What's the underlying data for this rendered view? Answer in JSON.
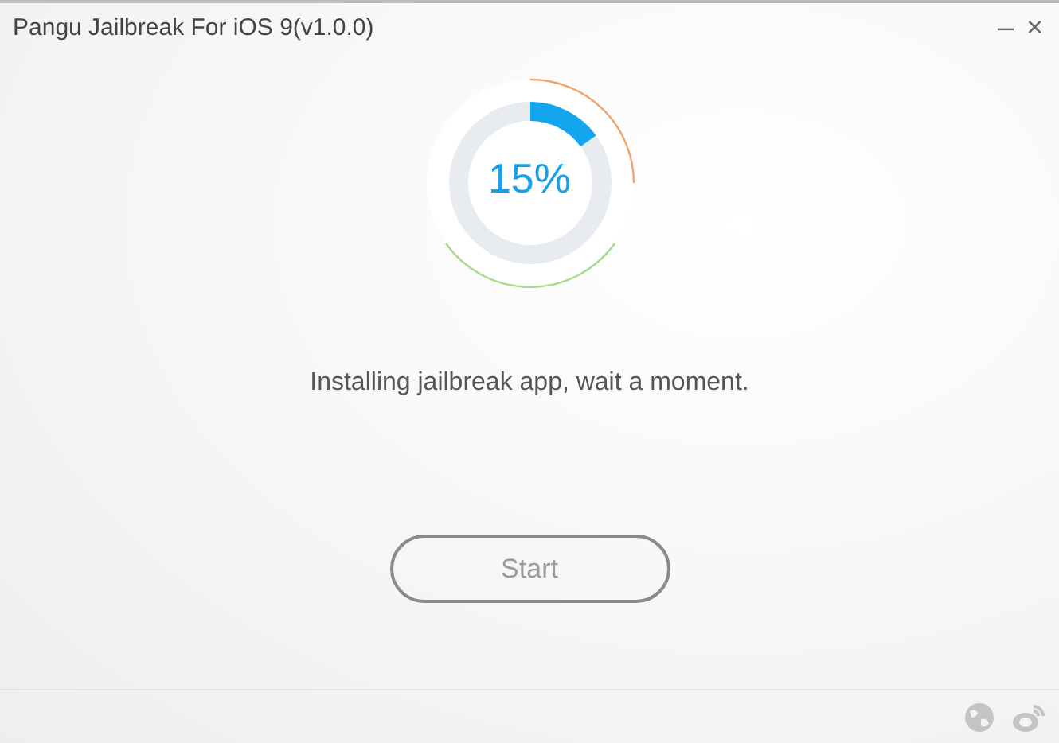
{
  "window": {
    "title": "Pangu Jailbreak For iOS 9(v1.0.0)",
    "controls": [
      "–",
      "×"
    ]
  },
  "progress": {
    "level": 0.15,
    "reading": "15%"
  },
  "status": "Installing jailbreak app, wait a moment.",
  "start_button": {
    "label": "Start",
    "disabled": true
  }
}
